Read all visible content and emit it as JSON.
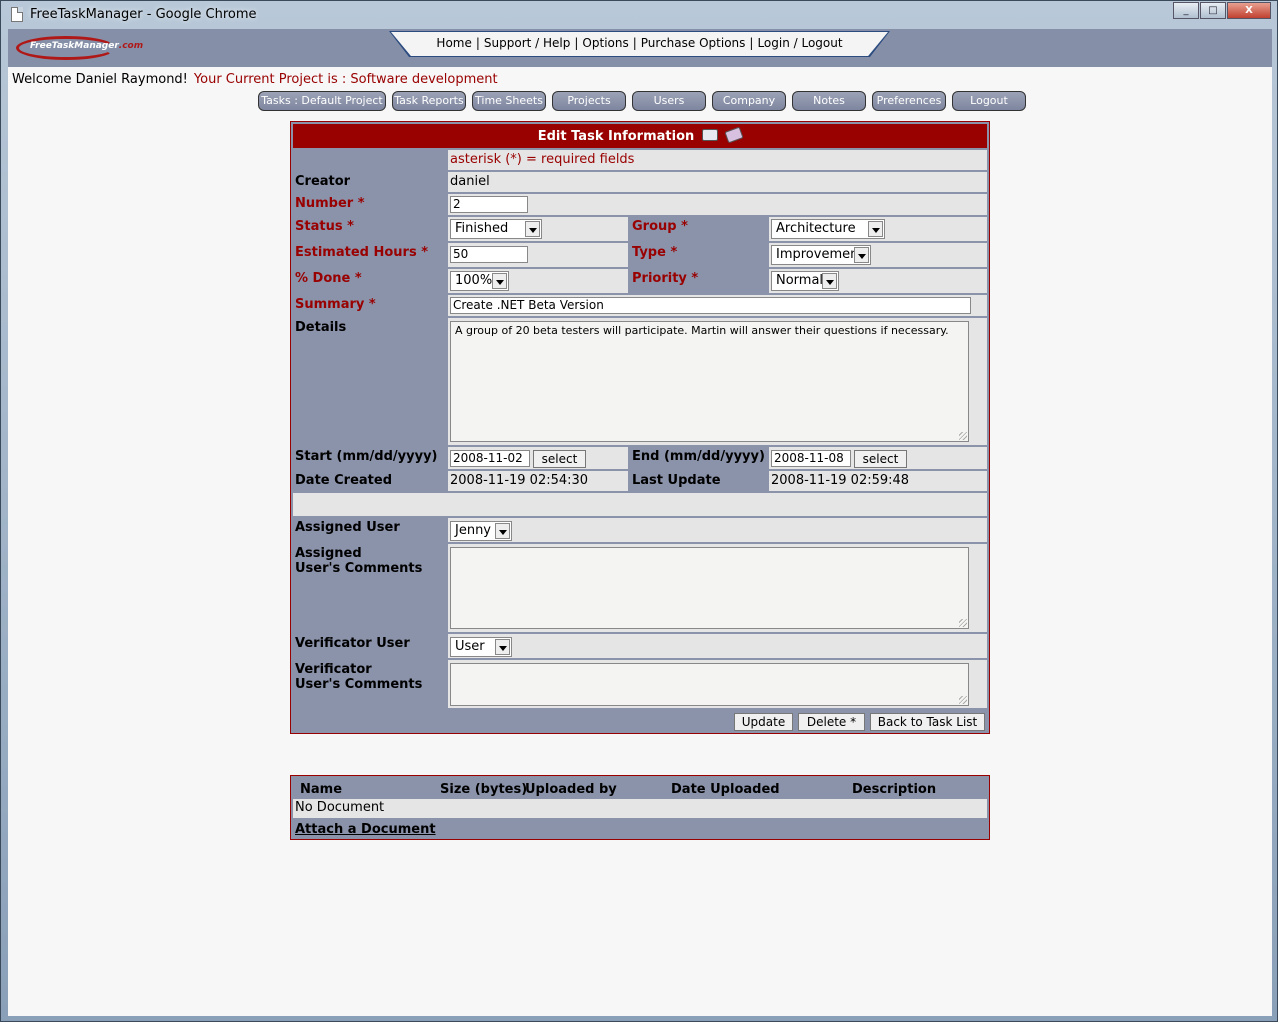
{
  "window": {
    "title": "FreeTaskManager - Google Chrome",
    "controls": [
      "_",
      "□",
      "X"
    ]
  },
  "logo": {
    "text_a": "FreeTaskManager",
    "text_b": ".com"
  },
  "topnav": [
    "Home",
    "Support / Help",
    "Options",
    "Purchase Options",
    "Login / Logout"
  ],
  "welcome": {
    "greeting": "Welcome Daniel Raymond!",
    "project": "Your Current Project is : Software development"
  },
  "tabs": [
    "Tasks : Default Project",
    "Task Reports",
    "Time Sheets",
    "Projects",
    "Users",
    "Company",
    "Notes",
    "Preferences",
    "Logout"
  ],
  "form": {
    "title": "Edit Task Information",
    "required_note": "asterisk (*) = required fields",
    "creator_label": "Creator",
    "creator": "daniel",
    "number_label": "Number *",
    "number": "2",
    "status_label": "Status *",
    "status": "Finished",
    "group_label": "Group *",
    "group": "Architecture",
    "hours_label": "Estimated Hours *",
    "hours": "50",
    "type_label": "Type *",
    "type": "Improvement",
    "done_label": "% Done *",
    "done": "100%",
    "priority_label": "Priority *",
    "priority": "Normal",
    "summary_label": "Summary *",
    "summary": "Create .NET Beta Version",
    "details_label": "Details",
    "details": "A group of 20 beta testers will participate. Martin will answer their questions if necessary.",
    "start_label": "Start (mm/dd/yyyy)",
    "start": "2008-11-02",
    "end_label": "End (mm/dd/yyyy)",
    "end": "2008-11-08",
    "select_label": "select",
    "created_label": "Date Created",
    "created": "2008-11-19 02:54:30",
    "updated_label": "Last Update",
    "updated": "2008-11-19 02:59:48",
    "assigned_label": "Assigned User",
    "assigned": "Jenny",
    "assigned_comments_label_1": "Assigned",
    "assigned_comments_label_2": "User's Comments",
    "verificator_label": "Verificator User",
    "verificator": "User",
    "verificator_comments_label_1": "Verificator",
    "verificator_comments_label_2": "User's Comments",
    "update_button": "Update",
    "delete_button": "Delete *",
    "back_button": "Back to Task List"
  },
  "documents": {
    "columns": [
      "Name",
      "Size (bytes)",
      "Uploaded by",
      "Date Uploaded",
      "Description"
    ],
    "empty": "No Document",
    "attach": "Attach a Document"
  }
}
